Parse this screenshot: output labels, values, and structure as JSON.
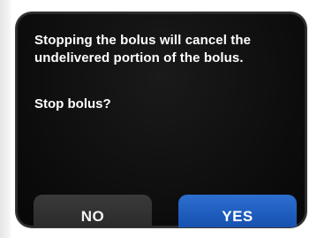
{
  "dialog": {
    "message": "Stopping the bolus will cancel the undelivered portion of the bolus.",
    "question": "Stop bolus?"
  },
  "buttons": {
    "no_label": "NO",
    "yes_label": "YES"
  },
  "colors": {
    "screen_background": "#0c0c0c",
    "text": "#ffffff",
    "no_button": "#303030",
    "yes_button": "#1f5fbf"
  }
}
